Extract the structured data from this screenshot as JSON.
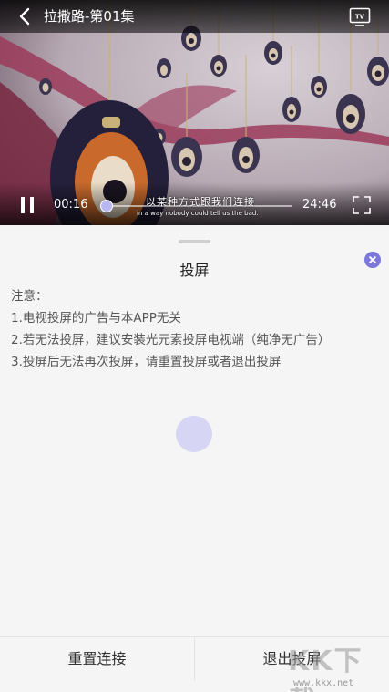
{
  "player": {
    "title": "拉撒路-第01集",
    "current_time": "00:16",
    "total_time": "24:46",
    "progress": 0.011,
    "subtitle_cn": "以某种方式跟我们连接",
    "subtitle_en": "in a way nobody could tell us the bad.",
    "accent_color": "#9a96e8",
    "icons": [
      "back-icon",
      "tv-cast-icon",
      "pause-icon",
      "fullscreen-icon"
    ]
  },
  "cast_panel": {
    "title": "投屏",
    "notes": [
      "注意：",
      "1.电视投屏的广告与本APP无关",
      "2.若无法投屏，建议安装光元素投屏电视端（纯净无广告）",
      "3.投屏后无法再次投屏，请重置投屏或者退出投屏"
    ],
    "close_color": "#7b77db",
    "reset_label": "重置连接",
    "exit_label": "退出投屏"
  },
  "watermark": {
    "text": "KK下载",
    "url": "www.kkx.net"
  }
}
